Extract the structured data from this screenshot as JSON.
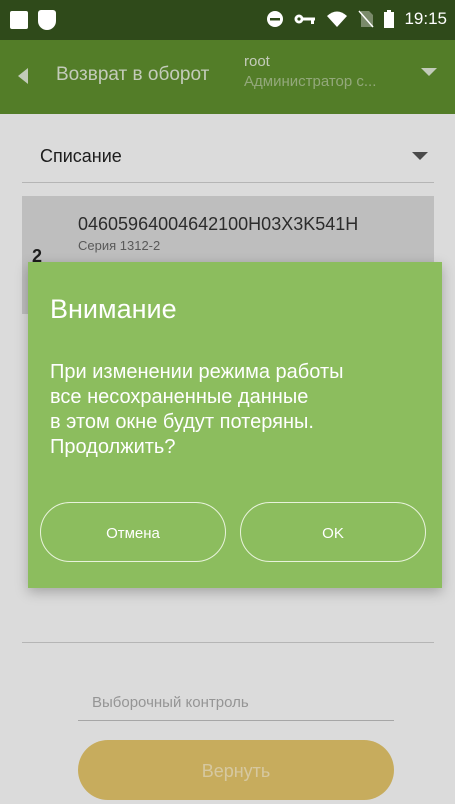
{
  "status_bar": {
    "time": "19:15",
    "left_icons": [
      "image-icon",
      "shield-icon"
    ],
    "right_icons": [
      "do-not-disturb-icon",
      "vpn-key-icon",
      "wifi-icon",
      "no-sim-icon",
      "battery-icon"
    ]
  },
  "app_bar": {
    "title": "Возврат в оборот",
    "user_name": "root",
    "user_role": "Администратор с...",
    "color": "#5f8f2e"
  },
  "mode_select": {
    "value": "Списание"
  },
  "item": {
    "code": "04605964004642100H03X3K541H",
    "series": "Серия 1312-2",
    "qty": "2"
  },
  "selective_control": {
    "placeholder": "Выборочный контроль"
  },
  "return_button": {
    "label": "Вернуть"
  },
  "dialog": {
    "title": "Внимание",
    "message": "При изменении режима работы\nвсе несохраненные данные\nв этом окне будут потеряны.\nПродолжить?",
    "cancel_label": "Отмена",
    "ok_label": "OK",
    "color": "#8cbd5e"
  }
}
